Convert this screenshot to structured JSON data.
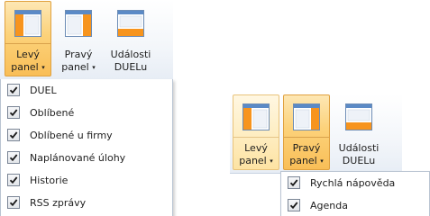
{
  "panel_group_left": {
    "buttons": [
      {
        "line1": "Levý",
        "line2": "panel",
        "state": "pressed"
      },
      {
        "line1": "Pravý",
        "line2": "panel",
        "state": "normal"
      },
      {
        "line1": "Události",
        "line2": "DUELu",
        "state": "normal"
      }
    ],
    "dropdown_arrow": "▾",
    "menu_items": [
      {
        "label": "DUEL",
        "checked": true
      },
      {
        "label": "Oblíbené",
        "checked": true
      },
      {
        "label": "Oblíbené u firmy",
        "checked": true
      },
      {
        "label": "Naplánované úlohy",
        "checked": true
      },
      {
        "label": "Historie",
        "checked": true
      },
      {
        "label": "RSS zprávy",
        "checked": true
      }
    ]
  },
  "panel_group_right": {
    "buttons": [
      {
        "line1": "Levý",
        "line2": "panel",
        "state": "hover"
      },
      {
        "line1": "Pravý",
        "line2": "panel",
        "state": "pressed"
      },
      {
        "line1": "Události",
        "line2": "DUELu",
        "state": "normal"
      }
    ],
    "dropdown_arrow": "▾",
    "menu_items": [
      {
        "label": "Rychlá nápověda",
        "checked": true
      },
      {
        "label": "Agenda",
        "checked": true
      }
    ]
  },
  "colors": {
    "pressed_fill": "#f9be57",
    "hover_fill": "#feeec4",
    "icon_orange": "#f7941d",
    "icon_blue": "#4f81bd"
  },
  "icons": [
    "left-panel-icon",
    "right-panel-icon",
    "events-panel-icon",
    "checkmark-icon",
    "dropdown-arrow-icon"
  ]
}
